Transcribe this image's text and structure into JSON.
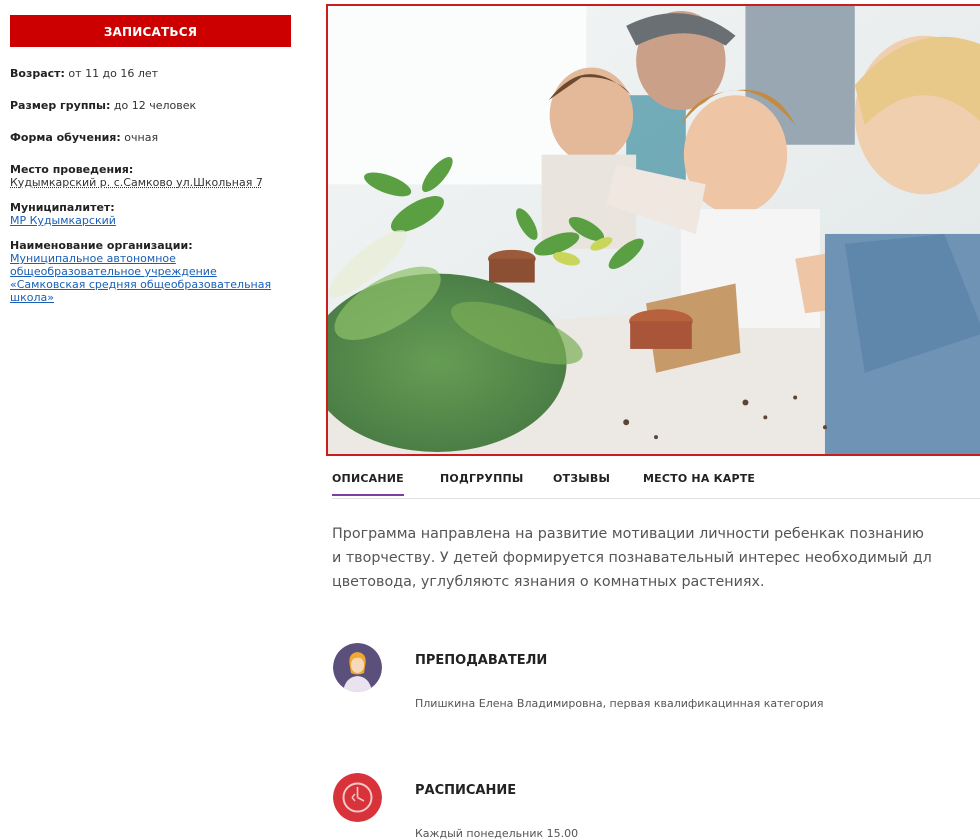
{
  "enroll": {
    "label": "ЗАПИСАТЬСЯ"
  },
  "info": {
    "age_label": "Возраст:",
    "age_value": " от 11 до 16 лет",
    "group_label": "Размер группы:",
    "group_value": " до 12 человек",
    "form_label": "Форма обучения:",
    "form_value": " очная",
    "place_label": "Место проведения:",
    "place_value": "Кудымкарский р. с.Самково ул.Школьная 7",
    "municipality_label": "Муниципалитет:",
    "municipality_value": "МР Кудымкарский",
    "org_label": "Наименование организации:",
    "org_value_1": "Муниципальное автономное",
    "org_value_2": "общеобразовательное учреждение",
    "org_value_3": "«Самковская средняя общеобразовательная",
    "org_value_4": "школа»"
  },
  "tabs": [
    {
      "label": "ОПИСАНИЕ",
      "active": true
    },
    {
      "label": "ПОДГРУППЫ",
      "active": false
    },
    {
      "label": "ОТЗЫВЫ",
      "active": false
    },
    {
      "label": "МЕСТО НА КАРТЕ",
      "active": false
    }
  ],
  "description": {
    "line1": "Программа направлена на развитие мотивации личности ребенкак познанию",
    "line2": "и творчеству. У детей формируется познавательный интерес необходимый дл",
    "line3": "цветовода, углубляютс язнания о комнатных растениях."
  },
  "teachers": {
    "title": "ПРЕПОДАВАТЕЛИ",
    "text": "Плишкина Елена Владимировна, первая квалификацинная категория",
    "icon": "teacher-avatar-icon"
  },
  "schedule": {
    "title": "РАСПИСАНИЕ",
    "text": "Каждый понедельник 15.00",
    "icon": "clock-icon"
  },
  "colors": {
    "accent_red": "#cc0000",
    "tab_underline": "#7a3fa0",
    "link": "#1a5fb4"
  }
}
